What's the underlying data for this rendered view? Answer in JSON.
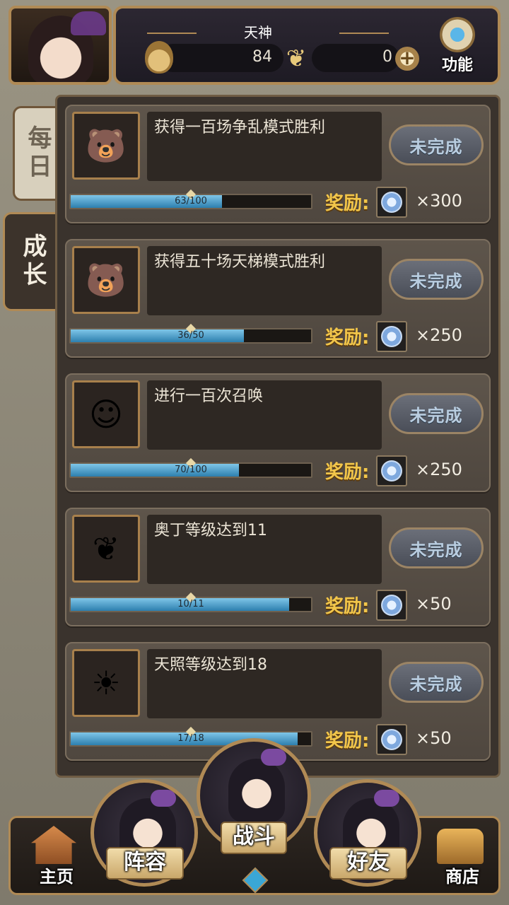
{
  "header": {
    "rank_title": "天神",
    "currency_flame_icon": "flame-coin-icon",
    "currency_main_value": "84",
    "currency_secondary_icon": "butterfly-icon",
    "currency_secondary_value": "0",
    "plus_icon": "plus-icon",
    "function_label": "功能",
    "function_icon": "gear-icon"
  },
  "tabs": {
    "daily": "每日",
    "growth": "成长",
    "active": "growth"
  },
  "quests": [
    {
      "desc": "获得一百场争乱模式胜利",
      "status": "未完成",
      "progress_text": "63/100",
      "progress": 0.63,
      "reward_label": "奖励:",
      "reward_amount": "×300",
      "icon": "chibi-bears-icon"
    },
    {
      "desc": "获得五十场天梯模式胜利",
      "status": "未完成",
      "progress_text": "36/50",
      "progress": 0.72,
      "reward_label": "奖励:",
      "reward_amount": "×250",
      "icon": "three-bears-icon"
    },
    {
      "desc": "进行一百次召唤",
      "status": "未完成",
      "progress_text": "70/100",
      "progress": 0.7,
      "reward_label": "奖励:",
      "reward_amount": "×250",
      "icon": "chibi-summon-icon"
    },
    {
      "desc": "奥丁等级达到11",
      "status": "未完成",
      "progress_text": "10/11",
      "progress": 0.909,
      "reward_label": "奖励:",
      "reward_amount": "×50",
      "icon": "golden-wings-icon"
    },
    {
      "desc": "天照等级达到18",
      "status": "未完成",
      "progress_text": "17/18",
      "progress": 0.944,
      "reward_label": "奖励:",
      "reward_amount": "×50",
      "icon": "sun-creature-icon"
    }
  ],
  "reward_coin_icon": "blue-coin-icon",
  "nav": {
    "home": "主页",
    "team": "阵容",
    "battle": "战斗",
    "friends": "好友",
    "shop": "商店"
  },
  "colors": {
    "accent_gold": "#b08a55",
    "reward_label": "#f2c64a",
    "progress_fill": "#2d7fae",
    "status_text": "#b9cde0"
  }
}
